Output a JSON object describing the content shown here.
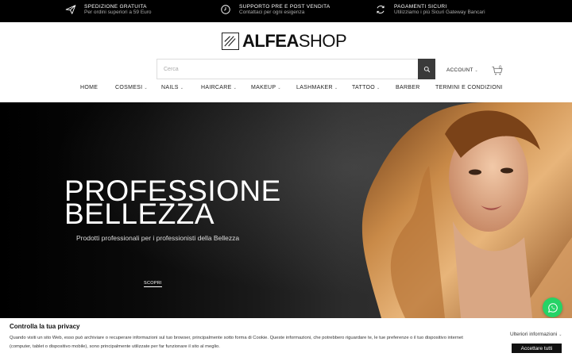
{
  "topbar": {
    "items": [
      {
        "icon": "paper-plane-icon",
        "title": "SPEDIZIONE GRATUITA",
        "subtitle": "Per ordini superiori a 59 Euro"
      },
      {
        "icon": "clock-icon",
        "title": "SUPPORTO PRE E POST VENDITA",
        "subtitle": "Contattaci per ogni esigenza"
      },
      {
        "icon": "refresh-icon",
        "title": "PAGAMENTI SICURI",
        "subtitle": "Utilizziamo i più Sicuri Gateway Bancari"
      }
    ]
  },
  "header": {
    "logo_bold": "ALFEA",
    "logo_light": "SHOP",
    "search_placeholder": "Cerca",
    "account_label": "ACCOUNT",
    "cart_count": "0"
  },
  "nav": {
    "items": [
      {
        "label": "HOME",
        "dropdown": false
      },
      {
        "label": "COSMESI",
        "dropdown": true
      },
      {
        "label": "NAILS",
        "dropdown": true
      },
      {
        "label": "HAIRCARE",
        "dropdown": true
      },
      {
        "label": "MAKEUP",
        "dropdown": true
      },
      {
        "label": "LASHMAKER",
        "dropdown": true
      },
      {
        "label": "TATTOO",
        "dropdown": true
      },
      {
        "label": "BARBER",
        "dropdown": false
      },
      {
        "label": "TERMINI E CONDIZIONI",
        "dropdown": false
      }
    ]
  },
  "hero": {
    "title_line1": "PROFESSIONE",
    "title_line2": "BELLEZZA",
    "subtitle": "Prodotti professionali per i professionisti della Bellezza",
    "cta": "SCOPRI"
  },
  "cookie": {
    "title": "Controlla la tua privacy",
    "text": "Quando visiti un sito Web, esso può archiviare o recuperare informazioni sul tuo browser, principalmente sotto forma di Cookie. Queste informazioni, che potrebbero riguardare te, le tue preferenze o il tuo dispositivo internet (computer, tablet o dispositivo mobile), sono principalmente utilizzate per far funzionare il sito al meglio.",
    "more_label": "Ulteriori informazioni",
    "accept_label": "Accettare tutti"
  },
  "colors": {
    "topbar_bg": "#000000",
    "accent": "#3a3a3a",
    "whatsapp": "#25d366"
  }
}
